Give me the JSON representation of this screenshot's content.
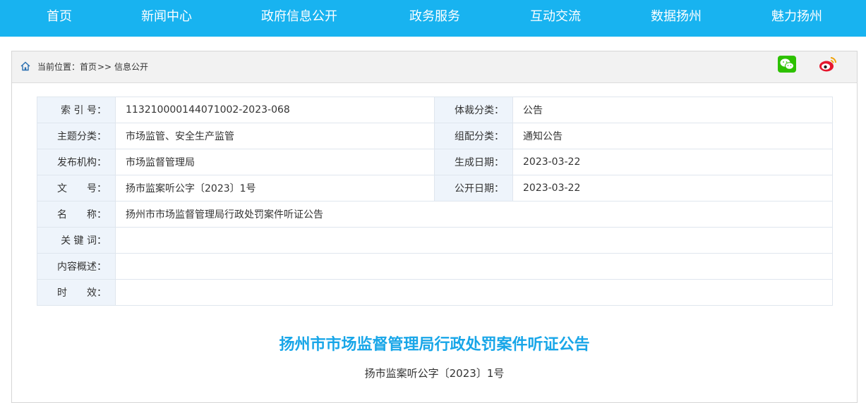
{
  "nav": {
    "items": [
      "首页",
      "新闻中心",
      "政府信息公开",
      "政务服务",
      "互动交流",
      "数据扬州",
      "魅力扬州"
    ]
  },
  "breadcrumb": {
    "prefix": "当前位置：",
    "home": "首页",
    "sep": " >> ",
    "current": "信息公开"
  },
  "share": {
    "wechat_icon": "wechat-icon",
    "weibo_icon": "weibo-icon",
    "wechat_color": "#2dc100",
    "weibo_color": "#e6162d"
  },
  "meta": {
    "index_label": "索 引 号：",
    "index_value": "113210000144071002-2023-068",
    "genre_label": "体裁分类：",
    "genre_value": "公告",
    "topic_label": "主题分类：",
    "topic_value": "市场监管、安全生产监管",
    "org_label": "组配分类：",
    "org_value": "通知公告",
    "publisher_label": "发布机构：",
    "publisher_value": "市场监督管理局",
    "created_label": "生成日期：",
    "created_value": "2023-03-22",
    "docno_label": "文　　号：",
    "docno_value": "扬市监案听公字〔2023〕1号",
    "public_label": "公开日期：",
    "public_value": "2023-03-22",
    "name_label": "名　　称：",
    "name_value": "扬州市市场监督管理局行政处罚案件听证公告",
    "keywords_label": "关 键 词：",
    "keywords_value": "",
    "summary_label": "内容概述：",
    "summary_value": "",
    "validity_label": "时　　效：",
    "validity_value": ""
  },
  "article": {
    "title": "扬州市市场监督管理局行政处罚案件听证公告",
    "doc_number": "扬市监案听公字〔2023〕1号"
  },
  "colors": {
    "nav_bg": "#18b3f0",
    "title": "#18a6e8",
    "label_bg": "#eef4fb"
  }
}
